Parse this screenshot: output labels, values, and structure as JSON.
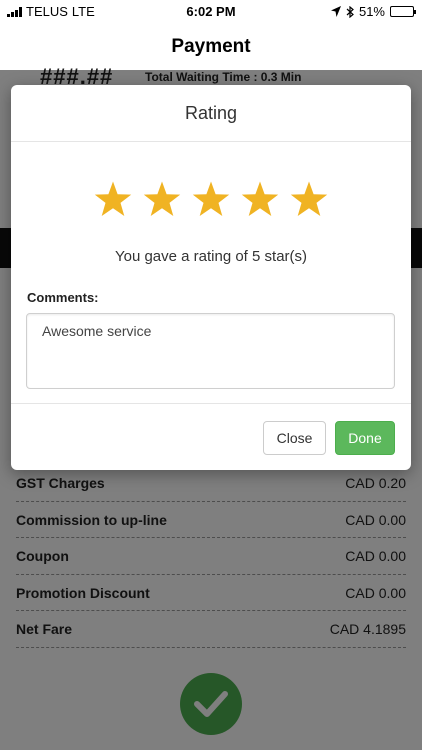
{
  "status_bar": {
    "carrier": "TELUS",
    "network": "LTE",
    "time": "6:02 PM",
    "battery_percent": "51%",
    "battery_level": 0.51,
    "icons": [
      "signal-icon",
      "location-arrow-icon",
      "bluetooth-icon",
      "battery-icon"
    ]
  },
  "nav": {
    "title": "Payment"
  },
  "background": {
    "total_amount": "###.##",
    "waiting_time": "Total Waiting Time : 0.3 Min",
    "fare_rows": [
      {
        "label": "GST Charges",
        "value": "CAD 0.20"
      },
      {
        "label": "Commission to up-line",
        "value": "CAD 0.00"
      },
      {
        "label": "Coupon",
        "value": "CAD 0.00"
      },
      {
        "label": "Promotion Discount",
        "value": "CAD 0.00"
      },
      {
        "label": "Net Fare",
        "value": "CAD 4.1895"
      }
    ],
    "confirm_icon": "checkmark-icon"
  },
  "modal": {
    "title": "Rating",
    "rating": 5,
    "rating_max": 5,
    "rating_text": "You gave a rating of 5 star(s)",
    "comments_label": "Comments:",
    "comments_value": "Awesome service",
    "close_label": "Close",
    "done_label": "Done"
  },
  "colors": {
    "star": "#f0b323",
    "done_button": "#5cb85c",
    "confirm_button": "#4cae50",
    "overlay": "rgba(0,0,0,0.5)"
  }
}
